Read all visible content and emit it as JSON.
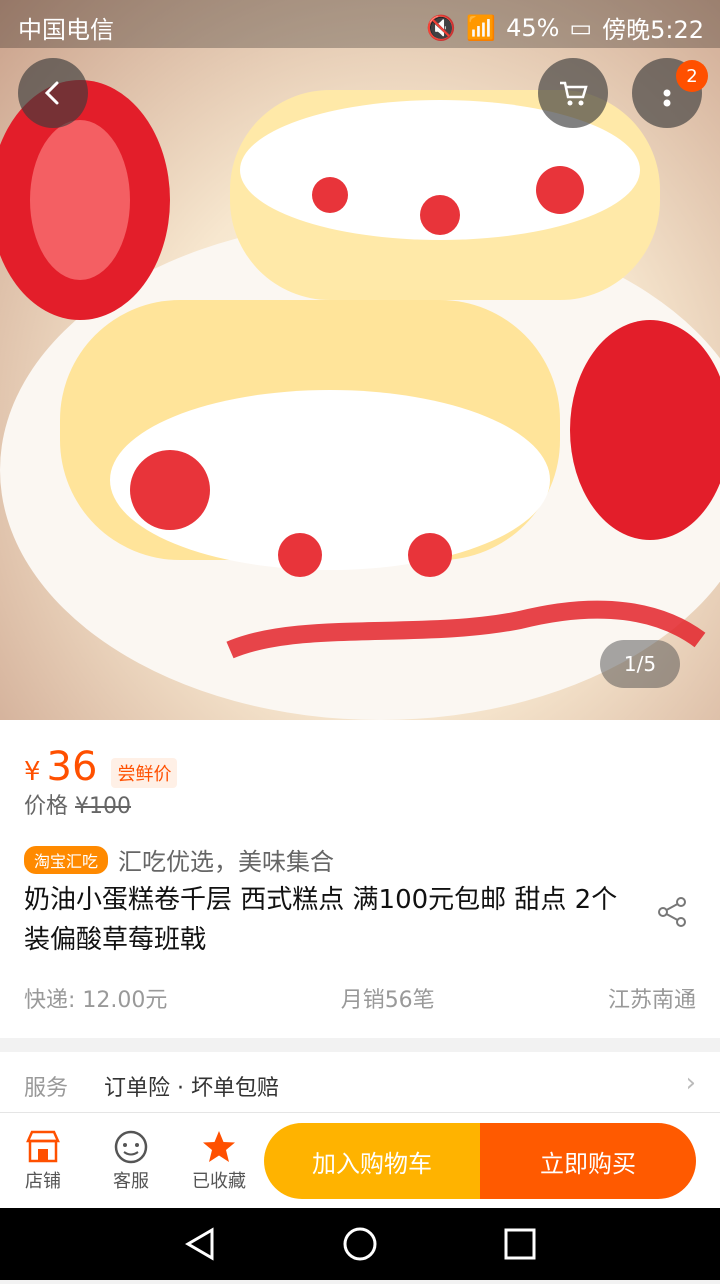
{
  "status": {
    "carrier": "中国电信",
    "battery": "45%",
    "time": "傍晚5:22"
  },
  "hero": {
    "pager": "1/5",
    "cart_badge": "2"
  },
  "product": {
    "currency": "¥",
    "price": "36",
    "price_tag": "尝鲜价",
    "orig_label": "价格",
    "orig_price": "¥100",
    "shop_tag": "淘宝汇吃",
    "slogan": "汇吃优选，美味集合",
    "title": "奶油小蛋糕卷千层 西式糕点 满100元包邮 甜点 2个装偏酸草莓班戟",
    "shipping": "快递: 12.00元",
    "sales": "月销56笔",
    "location": "江苏南通"
  },
  "service": {
    "label": "服务",
    "value": "订单险 · 坏单包赔"
  },
  "bottom_nav": {
    "shop": "店铺",
    "support": "客服",
    "favorited": "已收藏",
    "add_cart": "加入购物车",
    "buy_now": "立即购买"
  },
  "colors": {
    "accent": "#ff5000",
    "add_cart": "#ffb300",
    "buy": "#ff5a00"
  }
}
